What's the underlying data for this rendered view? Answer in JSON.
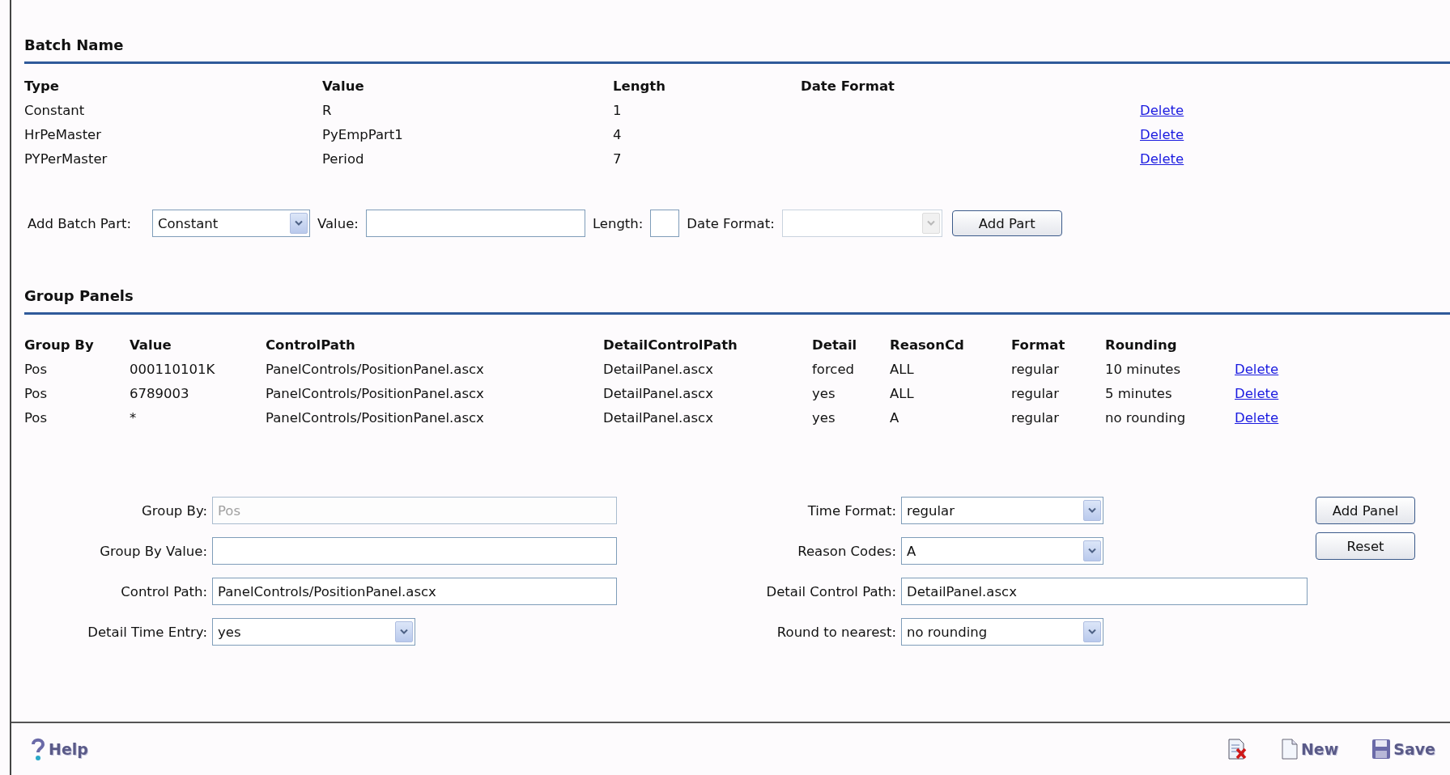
{
  "batch_name": {
    "title": "Batch Name",
    "columns": [
      "Type",
      "Value",
      "Length",
      "Date Format"
    ],
    "rows": [
      {
        "type": "Constant",
        "value": "R",
        "length": "1",
        "date_format": "",
        "action": "Delete"
      },
      {
        "type": "HrPeMaster",
        "value": "PyEmpPart1",
        "length": "4",
        "date_format": "",
        "action": "Delete"
      },
      {
        "type": "PYPerMaster",
        "value": "Period",
        "length": "7",
        "date_format": "",
        "action": "Delete"
      }
    ],
    "add_part": {
      "fields": [
        {
          "kind": "select",
          "label": "Add Batch Part:",
          "value": "Constant",
          "disabled": false
        },
        {
          "kind": "input",
          "label": "Value:",
          "disabled": false
        },
        {
          "kind": "short",
          "label": "Length:",
          "disabled": false
        },
        {
          "kind": "select",
          "label": "Date Format:",
          "disabled": true
        }
      ],
      "button": "Add Part"
    }
  },
  "group_panels": {
    "title": "Group Panels",
    "columns": [
      "Group By",
      "Value",
      "ControlPath",
      "DetailControlPath",
      "Detail",
      "ReasonCd",
      "Format",
      "Rounding"
    ],
    "rows": [
      {
        "cells": [
          "Pos",
          "000110101K",
          "PanelControls/PositionPanel.ascx",
          "DetailPanel.ascx",
          "forced",
          "ALL",
          "regular",
          "10 minutes"
        ],
        "action": "Delete"
      },
      {
        "cells": [
          "Pos",
          "6789003",
          "PanelControls/PositionPanel.ascx",
          "DetailPanel.ascx",
          "yes",
          "ALL",
          "regular",
          "5 minutes"
        ],
        "action": "Delete"
      },
      {
        "cells": [
          "Pos",
          "*",
          "PanelControls/PositionPanel.ascx",
          "DetailPanel.ascx",
          "yes",
          "A",
          "regular",
          "no rounding"
        ],
        "action": "Delete"
      }
    ],
    "left_fields": [
      {
        "kind": "input",
        "label": "Group By:",
        "value": "Pos",
        "disabled": true
      },
      {
        "kind": "input",
        "label": "Group By Value:",
        "disabled": false
      },
      {
        "kind": "input",
        "label": "Control Path:",
        "value": "PanelControls/PositionPanel.ascx",
        "disabled": false
      },
      {
        "kind": "select",
        "label": "Detail Time Entry:",
        "value": "yes",
        "disabled": false
      }
    ],
    "right_fields": [
      {
        "kind": "select",
        "label": "Time Format:",
        "value": "regular",
        "disabled": false
      },
      {
        "kind": "select",
        "label": "Reason Codes:",
        "value": "A",
        "disabled": false
      },
      {
        "kind": "input",
        "label": "Detail Control Path:",
        "value": "DetailPanel.ascx",
        "disabled": false
      },
      {
        "kind": "select",
        "label": "Round to nearest:",
        "value": "no rounding",
        "disabled": false
      }
    ],
    "buttons": [
      "Add Panel",
      "Reset"
    ]
  },
  "footer": {
    "help": "Help",
    "actions": [
      {
        "kind": "delete"
      },
      {
        "kind": "new",
        "label": "New"
      },
      {
        "kind": "save",
        "label": "Save"
      }
    ]
  }
}
